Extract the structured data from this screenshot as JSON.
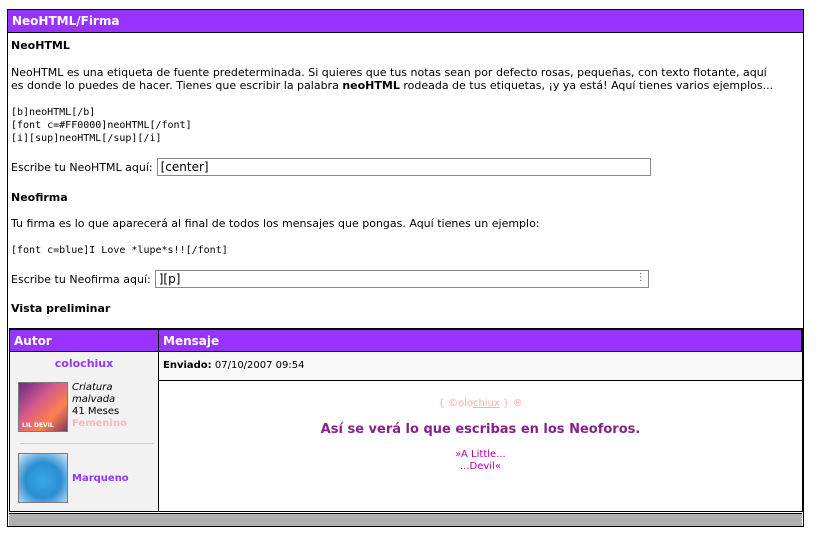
{
  "panel": {
    "title": "NeoHTML/Firma"
  },
  "neohtml": {
    "heading": "NeoHTML",
    "desc_line1": "NeoHTML es una etiqueta de fuente predeterminada. Si quieres que tus notas sean por defecto rosas, pequeñas, con texto flotante, aquí",
    "desc_line2_pre": "es donde lo puedes de hacer. Tienes que escribir la palabra ",
    "desc_line2_bold": "neoHTML",
    "desc_line2_post": " rodeada de tus etiquetas, ¡y ya está! Aquí tienes varios ejemplos...",
    "examples": [
      "[b]neoHTML[/b]",
      "[font c=#FF0000]neoHTML[/font]",
      "[i][sup]neoHTML[/sup][/i]"
    ],
    "input_label": "Escribe tu NeoHTML aquí:",
    "input_value": "[center]"
  },
  "neofirma": {
    "heading": "Neofirma",
    "desc": "Tu firma es lo que aparecerá al final de todos los mensajes que pongas. Aquí tienes un ejemplo:",
    "example": "[font c=blue]I Love *lupe*s!![/font]",
    "input_label": "Escribe tu Neofirma aquí:",
    "input_value": "][p]"
  },
  "preview": {
    "heading": "Vista preliminar",
    "col_author": "Autor",
    "col_message": "Mensaje",
    "username": "colochiux",
    "pet1": {
      "line1": "Criatura",
      "line2": "malvada",
      "age": "41 Meses",
      "gender": "Femenino",
      "avatar_text": "LIL DEVIL"
    },
    "pet2": {
      "name": "Marqueno"
    },
    "sent_label": "Enviado:",
    "sent_value": "07/10/2007 09:54",
    "sig_top_pre": "{ ©olo",
    "sig_top_u": "chiux",
    "sig_top_post": " } ®",
    "main_text": "Así se verá lo que escribas en los Neoforos.",
    "sub_line1": "»A Little...",
    "sub_line2": "...Devil«"
  },
  "colors": {
    "header": "#9a33ff",
    "username": "#9a33ff",
    "main_text": "#8b1f8b"
  }
}
